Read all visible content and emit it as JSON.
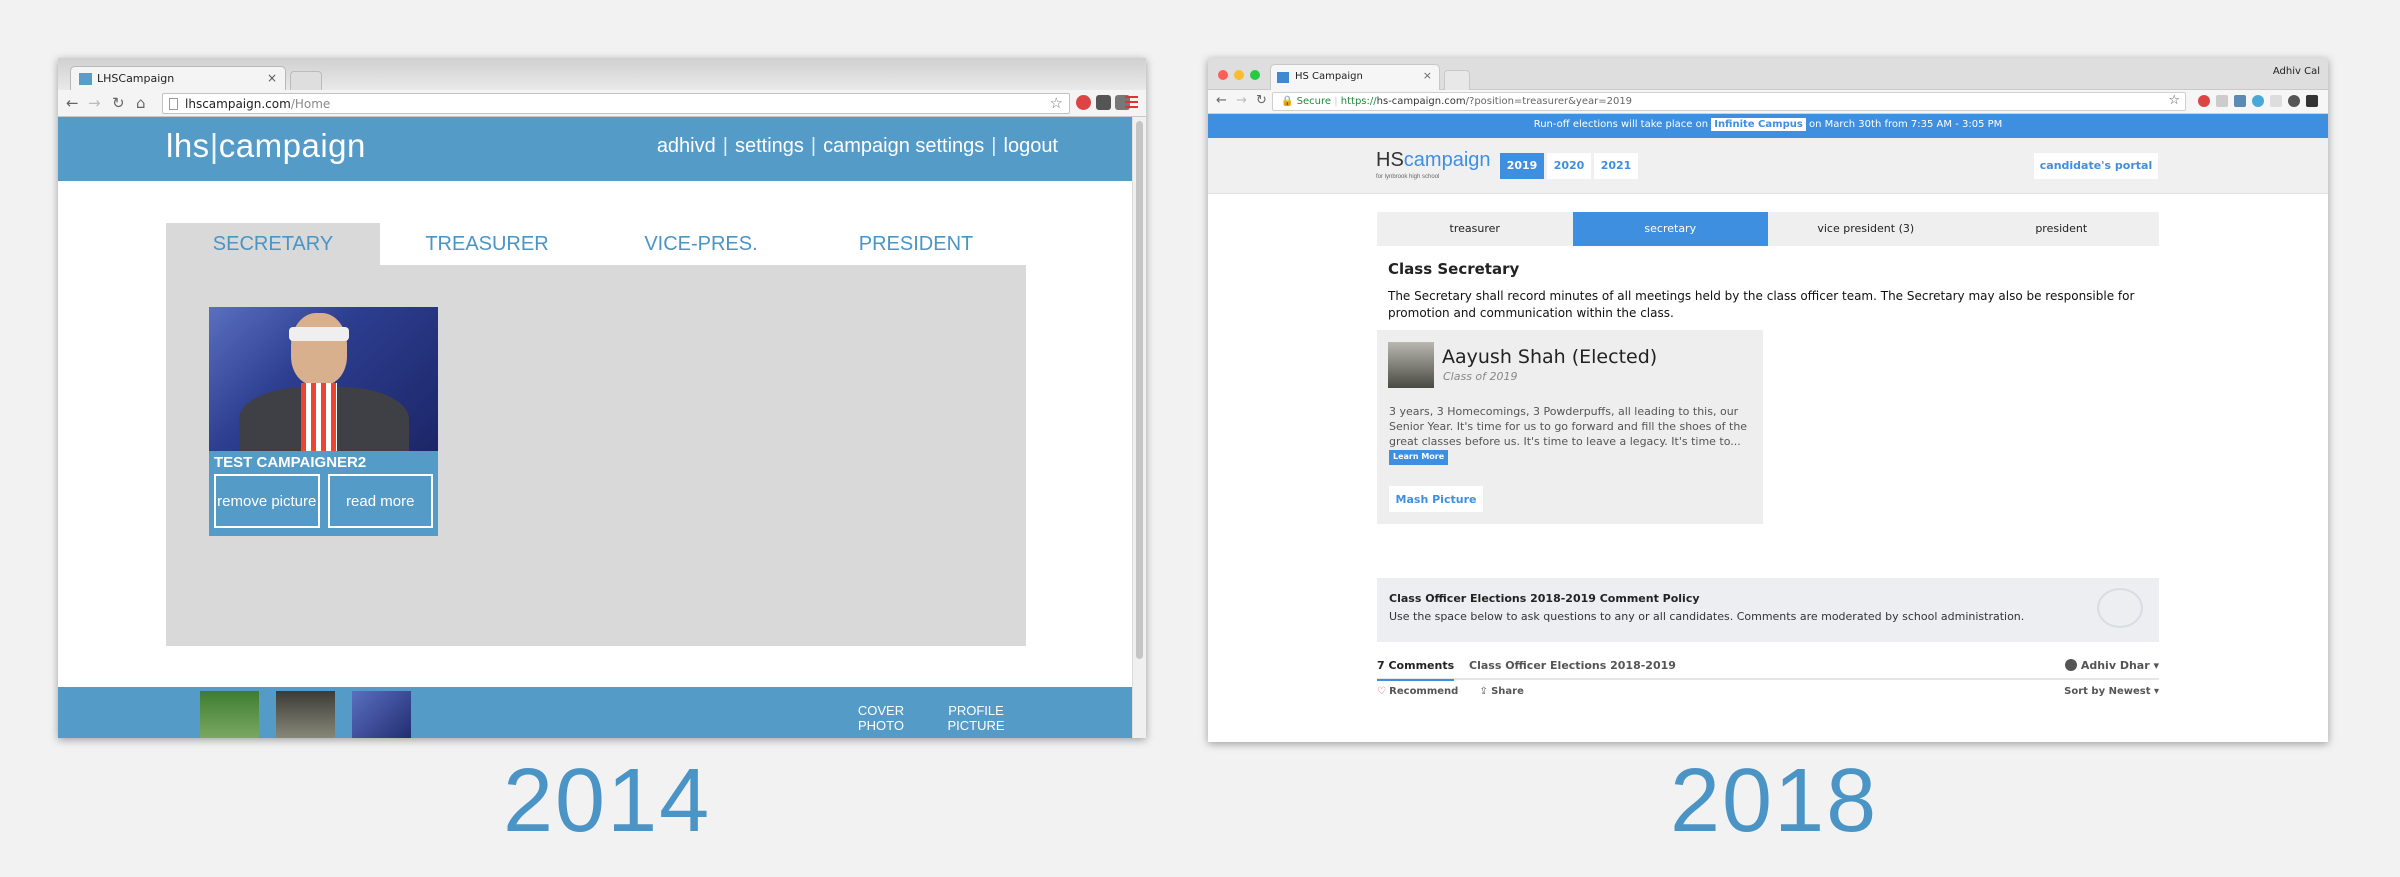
{
  "left": {
    "tab": {
      "title": "LHSCampaign",
      "close": "×"
    },
    "address": {
      "host": "lhscampaign.com",
      "path": "/Home"
    },
    "icons": {
      "back": "←",
      "forward": "→",
      "reload": "↻",
      "home": "⌂",
      "star": "☆"
    },
    "logo": {
      "lhs": "lhs",
      "bar": "|",
      "campaign": "campaign"
    },
    "nav": [
      "adhivd",
      "settings",
      "campaign settings",
      "logout"
    ],
    "nav_sep": "|",
    "position_tabs": [
      "SECRETARY",
      "TREASURER",
      "VICE-PRES.",
      "PRESIDENT"
    ],
    "card": {
      "name": "TEST CAMPAIGNER2",
      "remove_button": "remove picture",
      "read_more_button": "read more"
    },
    "footer": {
      "cover": "COVER PHOTO",
      "profile": "PROFILE PICTURE"
    }
  },
  "right": {
    "tab": {
      "title": "HS Campaign",
      "close": "×"
    },
    "user_name": "Adhiv Cal",
    "address": {
      "secure": "Secure",
      "https": "https://",
      "host": "hs-campaign.com",
      "query": "/?position=treasurer&year=2019"
    },
    "icons": {
      "back": "←",
      "forward": "→",
      "reload": "↻",
      "star": "☆"
    },
    "banner": {
      "before": "Run-off elections will take place on",
      "highlight": "Infinite Campus",
      "after": "on March 30th from 7:35 AM - 3:05 PM"
    },
    "logo": {
      "hs": "HS",
      "campaign": "campaign",
      "subtitle": "for lynbrook high school"
    },
    "years": [
      "2019",
      "2020",
      "2021"
    ],
    "portal_button": "candidate's portal",
    "position_tabs": [
      "treasurer",
      "secretary",
      "vice president (3)",
      "president"
    ],
    "role": {
      "title": "Class Secretary",
      "description": "The Secretary shall record minutes of all meetings held by the class officer team. The Secretary may also be responsible for promotion and communication within the class."
    },
    "candidate": {
      "name": "Aayush Shah (Elected)",
      "class": "Class of 2019",
      "bio": "3 years, 3 Homecomings, 3 Powderpuffs, all leading to this, our Senior Year. It's time for us to go forward and fill the shoes of the great classes before us. It's time to leave a legacy. It's time to...",
      "learn_more": "Learn More",
      "mash_button": "Mash Picture"
    },
    "policy": {
      "title": "Class Officer Elections 2018-2019 Comment Policy",
      "text": "Use the space below to ask questions to any or all candidates. Comments are moderated by school administration."
    },
    "comments": {
      "count_tab": "7 Comments",
      "forum_tab": "Class Officer Elections 2018-2019",
      "user": "Adhiv Dhar",
      "recommend": "Recommend",
      "share": "Share",
      "sort": "Sort by Newest"
    }
  },
  "captions": {
    "left": "2014",
    "right": "2018"
  },
  "colors": {
    "accent_2014": "#559bc8",
    "accent_2018": "#3f8fe0",
    "caption": "#4a94c6"
  }
}
